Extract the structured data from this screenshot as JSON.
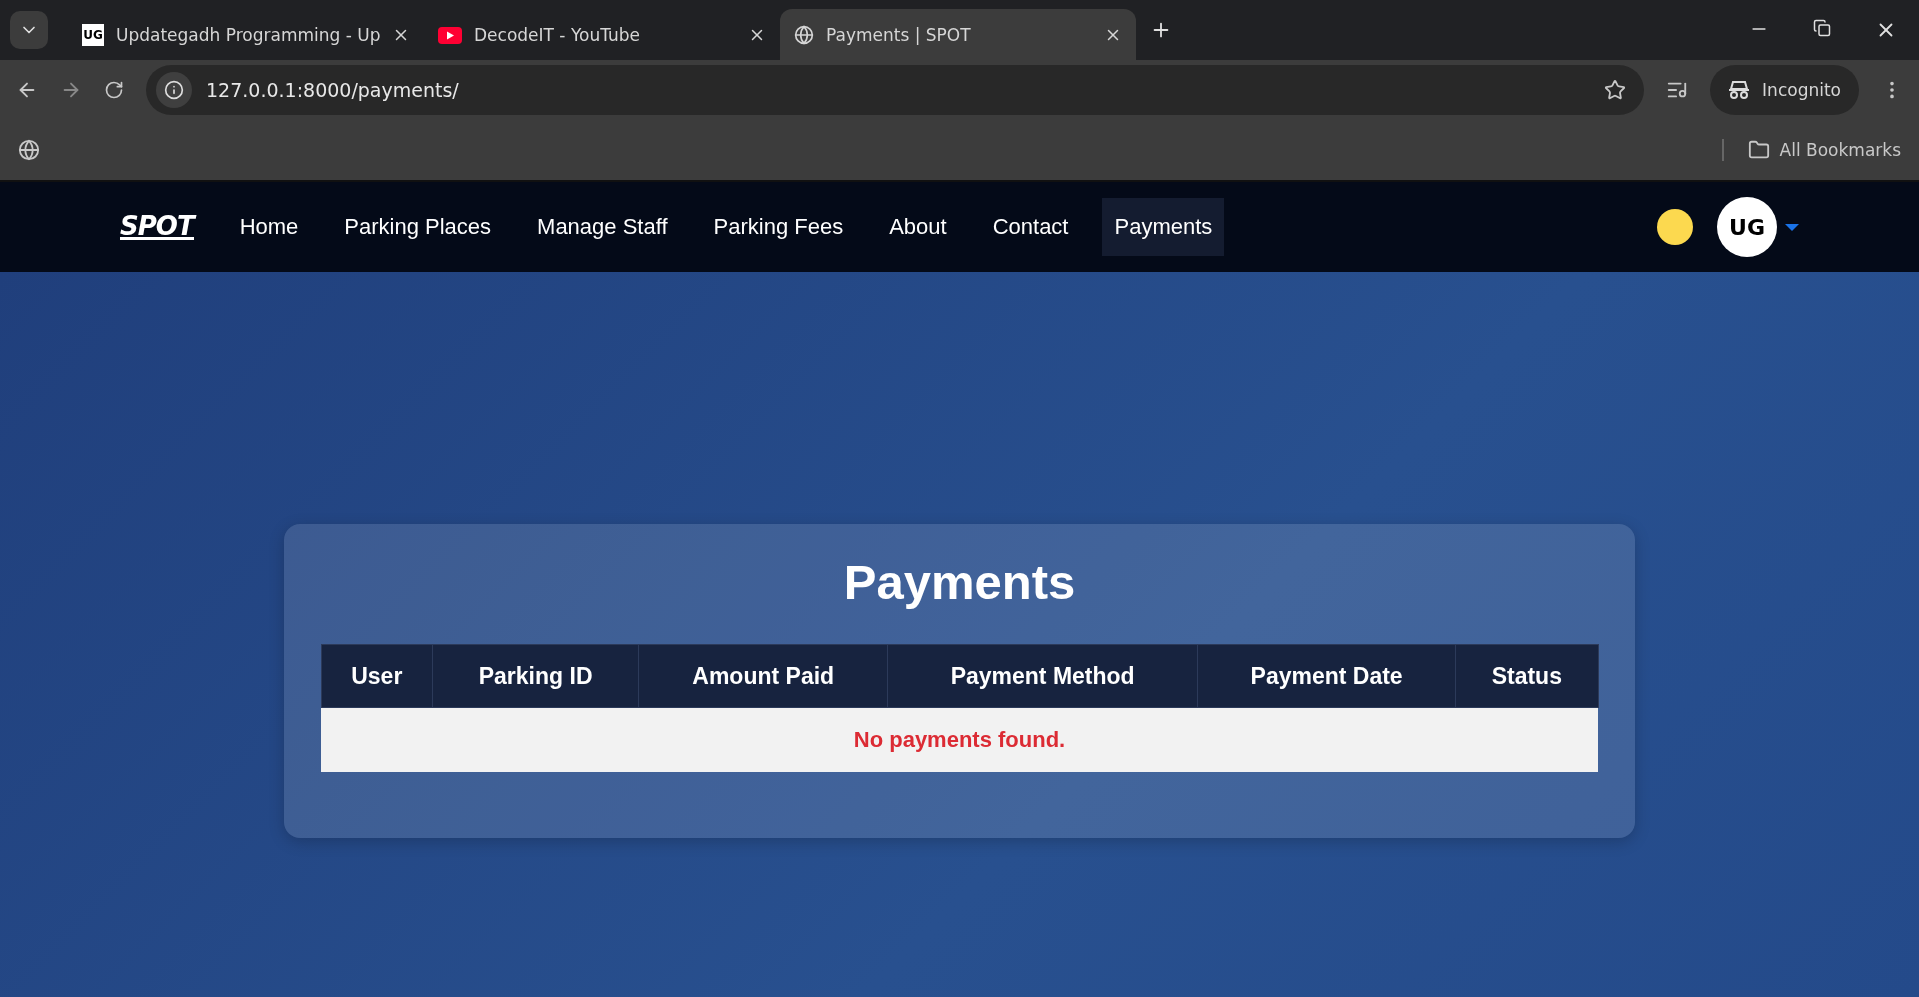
{
  "browser": {
    "tabs": [
      {
        "title": "Updategadh Programming - Up",
        "kind": "logo",
        "favicon_text": "UG",
        "selected": false
      },
      {
        "title": "DecodeIT - YouTube",
        "kind": "video",
        "selected": false
      },
      {
        "title": "Payments | SPOT",
        "kind": "web",
        "selected": true
      }
    ],
    "url": "127.0.0.1:8000/payments/",
    "profile": "Incognito",
    "bookmarks": "All Bookmarks"
  },
  "navbar": {
    "logo": "SPOT",
    "items": [
      {
        "label": "Home",
        "selected": false
      },
      {
        "label": "Parking Places",
        "selected": false
      },
      {
        "label": "Manage Staff",
        "selected": false
      },
      {
        "label": "Parking Fees",
        "selected": false
      },
      {
        "label": "About",
        "selected": false
      },
      {
        "label": "Contact",
        "selected": false
      },
      {
        "label": "Payments",
        "selected": true
      }
    ],
    "avatar": "UG"
  },
  "card": {
    "title": "Payments",
    "table": {
      "columns": [
        "User",
        "Parking ID",
        "Amount Paid",
        "Payment Method",
        "Payment Date",
        "Status"
      ],
      "empty_message": "No payments found."
    }
  }
}
